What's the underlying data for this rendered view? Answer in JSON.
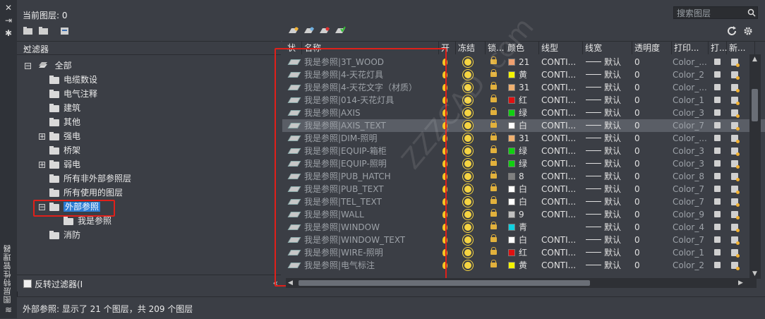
{
  "palette": {
    "title": "图层特性管理器"
  },
  "header": {
    "current_layer": "当前图层: 0",
    "search_placeholder": "搜索图层"
  },
  "filters": {
    "title": "过滤器",
    "invert_label": "反转过滤器(I",
    "items": [
      {
        "label": "全部",
        "expander": "−"
      },
      {
        "label": "电缆数设"
      },
      {
        "label": "电气注释"
      },
      {
        "label": "建筑"
      },
      {
        "label": "其他"
      },
      {
        "label": "强电",
        "expander": "+"
      },
      {
        "label": "桥架"
      },
      {
        "label": "弱电",
        "expander": "+"
      },
      {
        "label": "所有非外部参照层"
      },
      {
        "label": "所有使用的图层"
      },
      {
        "label": "外部参照",
        "expander": "−",
        "selected": true
      },
      {
        "label": "我是参照"
      },
      {
        "label": "消防"
      }
    ]
  },
  "grid": {
    "columns": [
      "状",
      "名称",
      "开",
      "冻结",
      "锁...",
      "颜色",
      "线型",
      "线宽",
      "透明度",
      "打印...",
      "打...",
      "新..."
    ],
    "linewidth_default": "默认",
    "transparency": "0",
    "rows": [
      {
        "name": "我是参照|3T_WOOD",
        "color_name": "21",
        "color_hex": "#f0a070",
        "linetype": "CONTI...",
        "plot_style": "Color_..."
      },
      {
        "name": "我是参照|4-天花灯具",
        "color_name": "黄",
        "color_hex": "#f5f500",
        "linetype": "CONTI...",
        "plot_style": "Color_2"
      },
      {
        "name": "我是参照|4-天花文字（材质）",
        "color_name": "31",
        "color_hex": "#f0b070",
        "linetype": "CONTI...",
        "plot_style": "Color_..."
      },
      {
        "name": "我是参照|014-天花灯具",
        "color_name": "红",
        "color_hex": "#e01010",
        "linetype": "CONTI...",
        "plot_style": "Color_1"
      },
      {
        "name": "我是参照|AXIS",
        "color_name": "绿",
        "color_hex": "#10d010",
        "linetype": "CONTI...",
        "plot_style": "Color_3"
      },
      {
        "name": "我是参照|AXIS_TEXT",
        "color_name": "白",
        "color_hex": "#ffffff",
        "linetype": "CONTI...",
        "plot_style": "Color_7",
        "selected": true
      },
      {
        "name": "我是参照|DIM-照明",
        "color_name": "31",
        "color_hex": "#f0b070",
        "linetype": "CONTI...",
        "plot_style": "Color_..."
      },
      {
        "name": "我是参照|EQUIP-箱柜",
        "color_name": "绿",
        "color_hex": "#10d010",
        "linetype": "CONTI...",
        "plot_style": "Color_3"
      },
      {
        "name": "我是参照|EQUIP-照明",
        "color_name": "绿",
        "color_hex": "#10d010",
        "linetype": "CONTI...",
        "plot_style": "Color_3"
      },
      {
        "name": "我是参照|PUB_HATCH",
        "color_name": "8",
        "color_hex": "#808080",
        "linetype": "CONTI...",
        "plot_style": "Color_8"
      },
      {
        "name": "我是参照|PUB_TEXT",
        "color_name": "白",
        "color_hex": "#ffffff",
        "linetype": "CONTI...",
        "plot_style": "Color_7"
      },
      {
        "name": "我是参照|TEL_TEXT",
        "color_name": "白",
        "color_hex": "#ffffff",
        "linetype": "CONTI...",
        "plot_style": "Color_7"
      },
      {
        "name": "我是参照|WALL",
        "color_name": "9",
        "color_hex": "#c0c0c0",
        "linetype": "CONTI...",
        "plot_style": "Color_9"
      },
      {
        "name": "我是参照|WINDOW",
        "color_name": "青",
        "color_hex": "#10d0e0",
        "linetype": "",
        "plot_style": "Color_4"
      },
      {
        "name": "我是参照|WINDOW_TEXT",
        "color_name": "白",
        "color_hex": "#ffffff",
        "linetype": "CONTI...",
        "plot_style": "Color_7"
      },
      {
        "name": "我是参照|WIRE-照明",
        "color_name": "红",
        "color_hex": "#e01010",
        "linetype": "CONTI...",
        "plot_style": "Color_1"
      },
      {
        "name": "我是参照|电气标注",
        "color_name": "黄",
        "color_hex": "#f5f500",
        "linetype": "CONTI...",
        "plot_style": "Color_2"
      }
    ]
  },
  "watermark": "ZZZCAD .com",
  "status": {
    "text": "外部参照: 显示了 21 个图层，共 209 个图层"
  }
}
